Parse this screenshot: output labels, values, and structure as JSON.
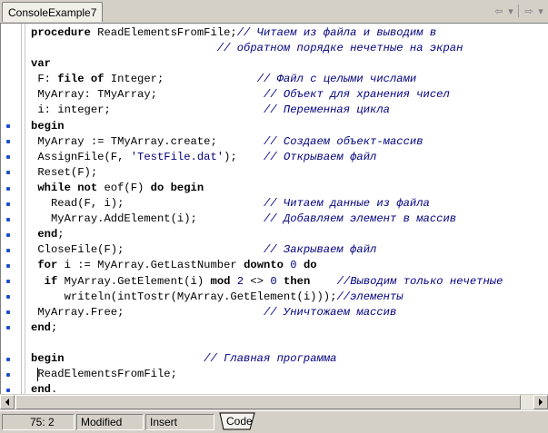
{
  "tabbar": {
    "tab_label": "ConsoleExample7",
    "back_glyph": "⇦",
    "dropdown_glyph": "▾",
    "forward_glyph": "⇨"
  },
  "editor": {
    "lines": [
      [
        {
          "t": "kw",
          "v": "procedure"
        },
        {
          "t": "tx",
          "v": " ReadElementsFromFile;"
        },
        {
          "t": "cm",
          "v": "// Читаем из файла и выводим в"
        }
      ],
      [
        {
          "t": "tx",
          "v": "                            "
        },
        {
          "t": "cm",
          "v": "// обратном порядке нечетные на экран"
        }
      ],
      [
        {
          "t": "kw",
          "v": "var"
        }
      ],
      [
        {
          "t": "tx",
          "v": " F: "
        },
        {
          "t": "kw",
          "v": "file of"
        },
        {
          "t": "tx",
          "v": " Integer;              "
        },
        {
          "t": "cm",
          "v": "// Файл с целыми числами"
        }
      ],
      [
        {
          "t": "tx",
          "v": " MyArray: TMyArray;                "
        },
        {
          "t": "cm",
          "v": "// Объект для хранения чисел"
        }
      ],
      [
        {
          "t": "tx",
          "v": " i: integer;                       "
        },
        {
          "t": "cm",
          "v": "// Переменная цикла"
        }
      ],
      [
        {
          "t": "kw",
          "v": "begin"
        }
      ],
      [
        {
          "t": "tx",
          "v": " MyArray := TMyArray.create;       "
        },
        {
          "t": "cm",
          "v": "// Создаем объект-массив"
        }
      ],
      [
        {
          "t": "tx",
          "v": " AssignFile(F, "
        },
        {
          "t": "st",
          "v": "'TestFile.dat'"
        },
        {
          "t": "tx",
          "v": ");    "
        },
        {
          "t": "cm",
          "v": "// Открываем файл"
        }
      ],
      [
        {
          "t": "tx",
          "v": " Reset(F);"
        }
      ],
      [
        {
          "t": "tx",
          "v": " "
        },
        {
          "t": "kw",
          "v": "while not"
        },
        {
          "t": "tx",
          "v": " eof(F) "
        },
        {
          "t": "kw",
          "v": "do begin"
        }
      ],
      [
        {
          "t": "tx",
          "v": "   Read(F, i);                     "
        },
        {
          "t": "cm",
          "v": "// Читаем данные из файла"
        }
      ],
      [
        {
          "t": "tx",
          "v": "   MyArray.AddElement(i);          "
        },
        {
          "t": "cm",
          "v": "// Добавляем элемент в массив"
        }
      ],
      [
        {
          "t": "tx",
          "v": " "
        },
        {
          "t": "kw",
          "v": "end"
        },
        {
          "t": "tx",
          "v": ";"
        }
      ],
      [
        {
          "t": "tx",
          "v": " CloseFile(F);                     "
        },
        {
          "t": "cm",
          "v": "// Закрываем файл"
        }
      ],
      [
        {
          "t": "tx",
          "v": " "
        },
        {
          "t": "kw",
          "v": "for"
        },
        {
          "t": "tx",
          "v": " i := MyArray.GetLastNumber "
        },
        {
          "t": "kw",
          "v": "downto"
        },
        {
          "t": "tx",
          "v": " "
        },
        {
          "t": "nm",
          "v": "0"
        },
        {
          "t": "tx",
          "v": " "
        },
        {
          "t": "kw",
          "v": "do"
        }
      ],
      [
        {
          "t": "tx",
          "v": "  "
        },
        {
          "t": "kw",
          "v": "if"
        },
        {
          "t": "tx",
          "v": " MyArray.GetElement(i) "
        },
        {
          "t": "kw",
          "v": "mod"
        },
        {
          "t": "tx",
          "v": " "
        },
        {
          "t": "nm",
          "v": "2"
        },
        {
          "t": "tx",
          "v": " <> "
        },
        {
          "t": "nm",
          "v": "0"
        },
        {
          "t": "tx",
          "v": " "
        },
        {
          "t": "kw",
          "v": "then"
        },
        {
          "t": "tx",
          "v": "    "
        },
        {
          "t": "cm",
          "v": "//Выводим только нечетные"
        }
      ],
      [
        {
          "t": "tx",
          "v": "     writeln(intTostr(MyArray.GetElement(i)));"
        },
        {
          "t": "cm",
          "v": "//элементы"
        }
      ],
      [
        {
          "t": "tx",
          "v": " MyArray.Free;                     "
        },
        {
          "t": "cm",
          "v": "// Уничтожаем массив"
        }
      ],
      [
        {
          "t": "kw",
          "v": "end"
        },
        {
          "t": "tx",
          "v": ";"
        }
      ],
      [],
      [
        {
          "t": "kw",
          "v": "begin"
        },
        {
          "t": "tx",
          "v": "                     "
        },
        {
          "t": "cm",
          "v": "// Главная программа"
        }
      ],
      [
        {
          "t": "tx",
          "v": " ReadElementsFromFile;"
        }
      ],
      [
        {
          "t": "kw",
          "v": "end"
        },
        {
          "t": "tx",
          "v": "."
        }
      ]
    ],
    "breakpoint_dot_rows": [
      6,
      7,
      8,
      9,
      10,
      11,
      12,
      13,
      14,
      15,
      16,
      17,
      18,
      19,
      21,
      22,
      23
    ]
  },
  "statusbar": {
    "position": "75:  2",
    "modified": "Modified",
    "insert_mode": "Insert",
    "code_tab": "Code"
  }
}
